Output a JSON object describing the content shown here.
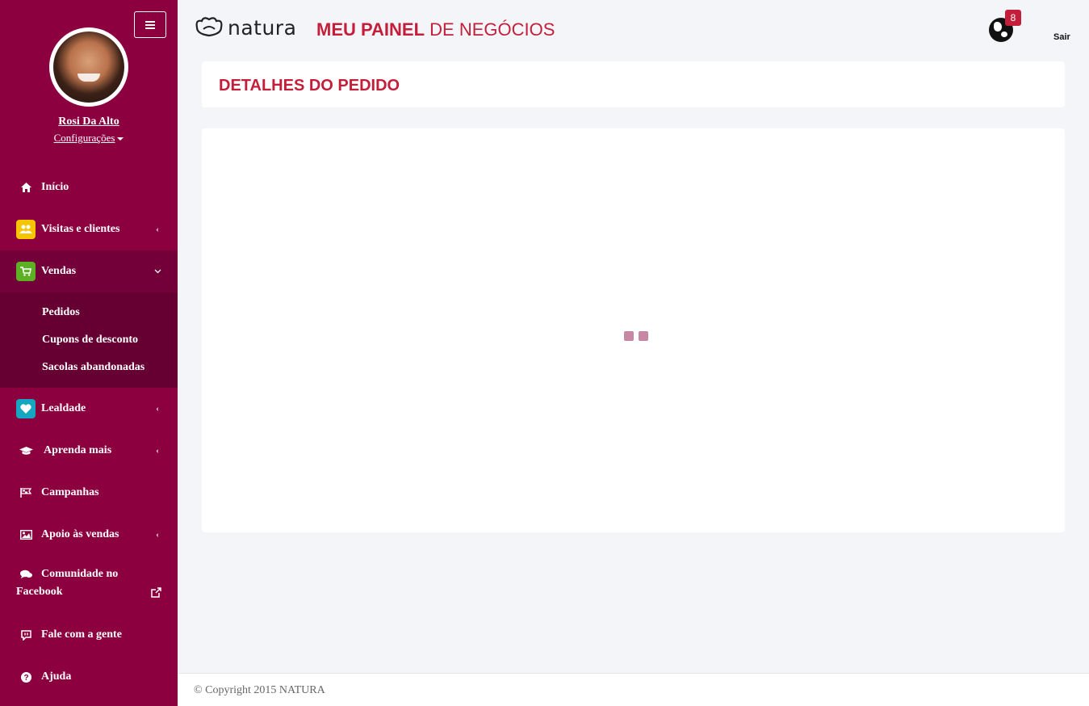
{
  "sidebar": {
    "user": {
      "name": "Rosi Da Alto",
      "config_label": "Configurações"
    },
    "items": [
      {
        "label": "Início",
        "icon": "home-icon"
      },
      {
        "label": "Visitas e clientes",
        "icon": "users-icon"
      },
      {
        "label": "Vendas",
        "icon": "cart-icon",
        "subitems": [
          "Pedidos",
          "Cupons de desconto",
          "Sacolas abandonadas"
        ]
      },
      {
        "label": "Lealdade",
        "icon": "heart-icon"
      },
      {
        "label": "Aprenda mais",
        "icon": "graduation-cap-icon"
      },
      {
        "label": "Campanhas",
        "icon": "flag-icon"
      },
      {
        "label": "Apoio às vendas",
        "icon": "image-icon"
      },
      {
        "label": "Comunidade no Facebook",
        "icon": "comments-icon"
      },
      {
        "label": "Fale com a gente",
        "icon": "chat-icon"
      },
      {
        "label": "Ajuda",
        "icon": "question-icon"
      }
    ]
  },
  "header": {
    "logo_text": "natura",
    "title_bold": "MEU PAINEL",
    "title_rest": " DE NEGÓCIOS",
    "notifications_count": "8",
    "logout_label": "Sair"
  },
  "main": {
    "page_title": "DETALHES DO PEDIDO"
  },
  "footer": {
    "copyright": "© Copyright 2015 NATURA"
  },
  "colors": {
    "sidebar": "#8c0040",
    "sidebar_active": "#74003a",
    "submenu": "#660033",
    "accent": "#c41f3a",
    "loader": "#c786a2",
    "background": "#f4f5f9"
  }
}
